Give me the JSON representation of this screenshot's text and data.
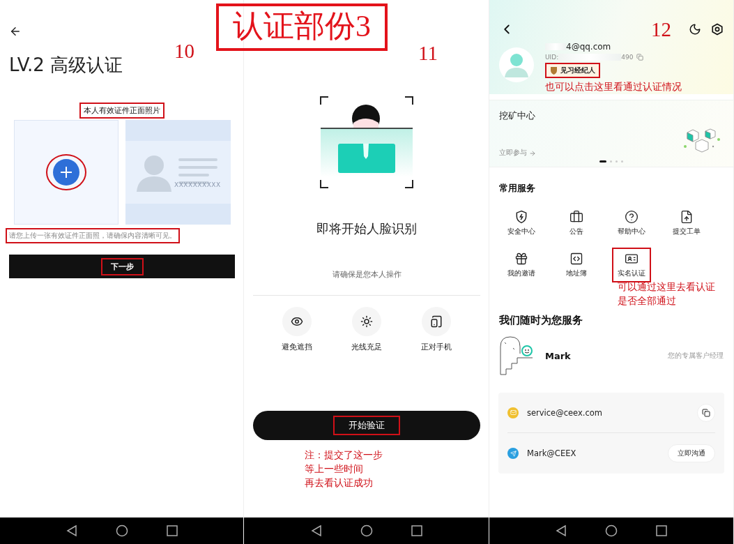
{
  "overlay_title": {
    "text": "认证部份3"
  },
  "screens": [
    {
      "kind": "id_upload",
      "number": "10",
      "title": "LV.2 高级认证",
      "upload_label": {
        "text": "本人有效证件正面照片",
        "highlighted": true
      },
      "upload_highlighted": true,
      "sample_id_text": "XXXXXXXXXX",
      "hint": {
        "text": "请您上传一张有效证件正面照，请确保内容清晰可见。",
        "highlighted": true
      },
      "button": {
        "text": "下一步",
        "highlighted": true
      }
    },
    {
      "kind": "face",
      "number": "11",
      "heading": "即将开始人脸识别",
      "subtitle": "请确保是您本人操作",
      "tips": [
        {
          "label": "避免遮挡"
        },
        {
          "label": "光线充足"
        },
        {
          "label": "正对手机"
        }
      ],
      "button": {
        "text": "开始验证",
        "highlighted": true
      },
      "note": [
        "注：提交了这一步",
        "等上一些时间",
        "再去看认证成功"
      ]
    },
    {
      "kind": "account",
      "number": "12",
      "email": "4@qq.com",
      "uid_label": "UID:",
      "uid_tail": "490",
      "badge": {
        "text": "见习经纪人",
        "highlighted": true
      },
      "badge_note": "也可以点击这里看通过认证情况",
      "promo": {
        "title": "挖矿中心",
        "link": "立即参与",
        "dots": [
          {
            "selected": true
          },
          {
            "selected": false
          },
          {
            "selected": false
          },
          {
            "selected": false
          }
        ]
      },
      "services_title": "常用服务",
      "services": [
        {
          "label": "安全中心",
          "highlighted": false
        },
        {
          "label": "公告",
          "highlighted": false
        },
        {
          "label": "帮助中心",
          "highlighted": false
        },
        {
          "label": "提交工单",
          "highlighted": false
        },
        {
          "label": "我的邀请",
          "highlighted": false
        },
        {
          "label": "地址簿",
          "highlighted": false
        },
        {
          "label": "实名认证",
          "highlighted": true
        }
      ],
      "services_note": [
        "可以通过这里去看认证",
        "是否全部通过"
      ],
      "support_title": "我们随时为您服务",
      "manager": {
        "name": "Mark",
        "role": "您的专属客户经理"
      },
      "contacts": [
        {
          "kind": "email",
          "value": "service@ceex.com"
        },
        {
          "kind": "chat",
          "value": "Mark@CEEX",
          "action": "立即沟通"
        }
      ]
    }
  ]
}
